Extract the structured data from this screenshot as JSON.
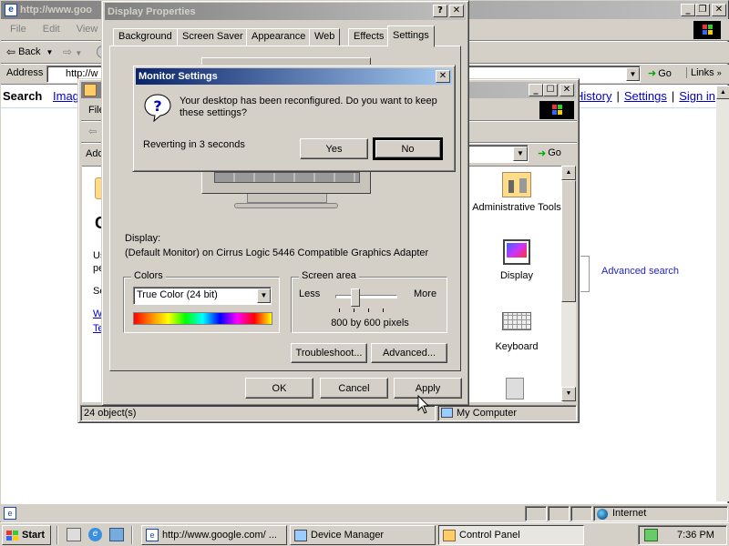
{
  "ie": {
    "title": "http://www.google.com/ - Microsoft Internet Explorer",
    "title_visible": "http://www.goo",
    "menu": [
      "File",
      "Edit",
      "View"
    ],
    "back_label": "Back",
    "address_label": "Address",
    "address_value": "http://w",
    "go_label": "Go",
    "links_label": "Links",
    "google_search_label": "Search",
    "google_images_label": "Imag",
    "google_right_links": [
      "History",
      "Settings",
      "Sign in"
    ],
    "advanced_search": "Advanced search",
    "status_zone": "Internet"
  },
  "cp": {
    "menu_first": "File",
    "address_label": "Add",
    "go_label": "Go",
    "left_heading_char": "C",
    "left_text": [
      "Us",
      "pe",
      "Se"
    ],
    "left_links": [
      "W",
      "Te"
    ],
    "icons": [
      {
        "label": "Administrative Tools",
        "icon": "admin-tools-icon"
      },
      {
        "label": "Display",
        "icon": "display-icon"
      },
      {
        "label": "Keyboard",
        "icon": "keyboard-icon"
      }
    ],
    "status_left": "24 object(s)",
    "status_right": "My Computer"
  },
  "dp": {
    "title": "Display Properties",
    "tabs": [
      "Background",
      "Screen Saver",
      "Appearance",
      "Web",
      "Effects",
      "Settings"
    ],
    "active_tab": "Settings",
    "display_label": "Display:",
    "display_value": "(Default Monitor) on Cirrus Logic 5446 Compatible Graphics Adapter",
    "colors_label": "Colors",
    "colors_value": "True Color (24 bit)",
    "screen_area_label": "Screen area",
    "less_label": "Less",
    "more_label": "More",
    "slider_level": 0.33,
    "resolution": "800 by 600 pixels",
    "troubleshoot_label": "Troubleshoot...",
    "advanced_label": "Advanced...",
    "ok_label": "OK",
    "cancel_label": "Cancel",
    "apply_label": "Apply"
  },
  "ms": {
    "title": "Monitor Settings",
    "message": "Your desktop has been reconfigured.  Do you want to keep these settings?",
    "countdown": "Reverting in 3 seconds",
    "yes_label": "Yes",
    "no_label": "No"
  },
  "taskbar": {
    "start_label": "Start",
    "tasks": [
      "http://www.google.com/ ...",
      "Device Manager",
      "Control Panel"
    ],
    "active_task": "Control Panel",
    "clock": "7:36 PM"
  },
  "colors": {
    "title_active": "#0a246a",
    "title_inactive": "#808080",
    "face": "#d4d0c8",
    "link": "#0000cc"
  }
}
